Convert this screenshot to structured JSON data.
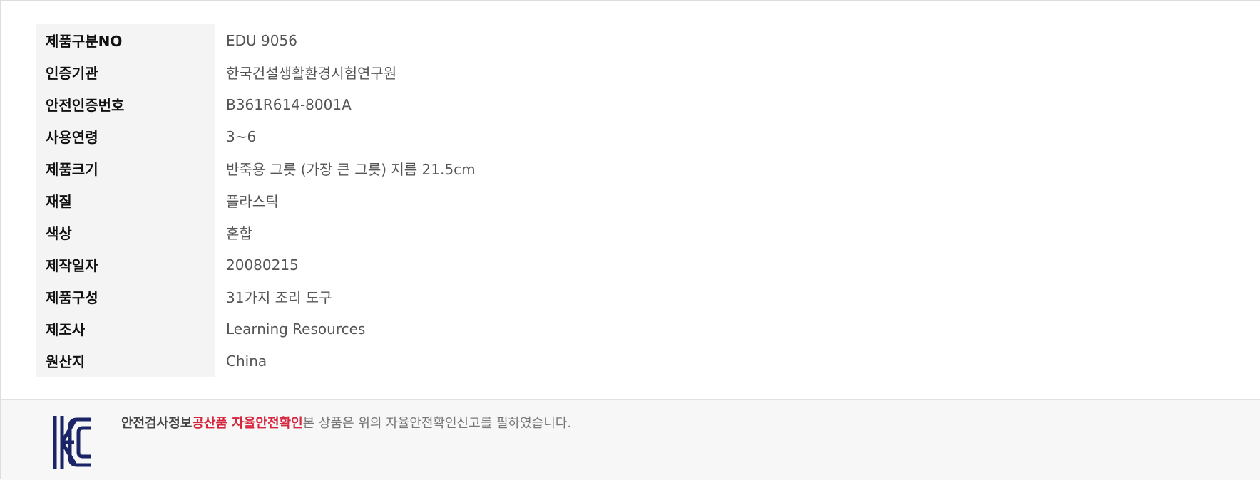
{
  "spec": {
    "rows": [
      {
        "label": "제품구분NO",
        "value": "EDU 9056"
      },
      {
        "label": "인증기관",
        "value": "한국건설생활환경시험연구원"
      },
      {
        "label": "안전인증번호",
        "value": "B361R614-8001A"
      },
      {
        "label": "사용연령",
        "value": "3~6"
      },
      {
        "label": "제품크기",
        "value": "반죽용 그릇 (가장 큰 그릇) 지름 21.5cm"
      },
      {
        "label": "재질",
        "value": "플라스틱"
      },
      {
        "label": "색상",
        "value": "혼합"
      },
      {
        "label": "제작일자",
        "value": "20080215"
      },
      {
        "label": "제품구성",
        "value": "31가지 조리 도구"
      },
      {
        "label": "제조사",
        "value": "Learning Resources"
      },
      {
        "label": "원산지",
        "value": "China"
      }
    ]
  },
  "safety": {
    "logo_icon": "kc-certification-icon",
    "title": "안전검사정보",
    "highlight": "공산품 자율안전확인",
    "description": "본 상품은 위의 자율안전확인신고를 필하였습니다.",
    "colors": {
      "highlight": "#d6263d",
      "logo": "#1a2466"
    }
  }
}
